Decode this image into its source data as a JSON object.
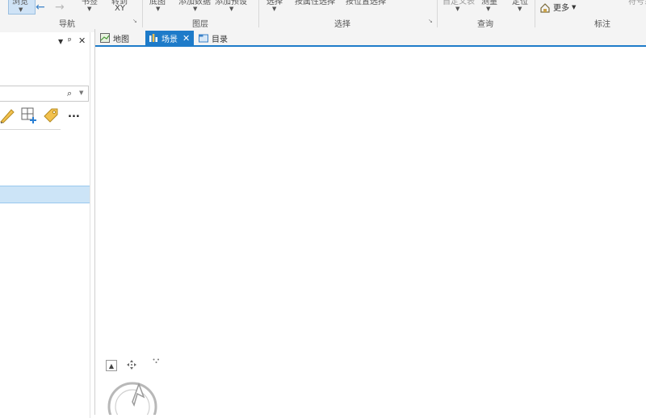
{
  "ribbon": {
    "clipped_labels": [
      "浏览",
      "书签",
      "转到",
      "XY",
      "底图",
      "添加数据",
      "添加预设",
      "选择",
      "按属性选择",
      "按位置选择",
      "自定义表",
      "测量",
      "定位",
      "符号系统"
    ],
    "more_label": "更多",
    "groups": {
      "navigate": "导航",
      "layer": "图层",
      "selection": "选择",
      "query": "查询",
      "label": "标注"
    }
  },
  "pane": {
    "search_placeholder": "",
    "more_tools_label": "..."
  },
  "tabs": [
    {
      "label": "地图",
      "active": false
    },
    {
      "label": "场景",
      "active": true
    },
    {
      "label": "目录",
      "active": false
    }
  ],
  "colors": {
    "accent": "#1e7bc9",
    "selected_row": "#cce4f7"
  }
}
